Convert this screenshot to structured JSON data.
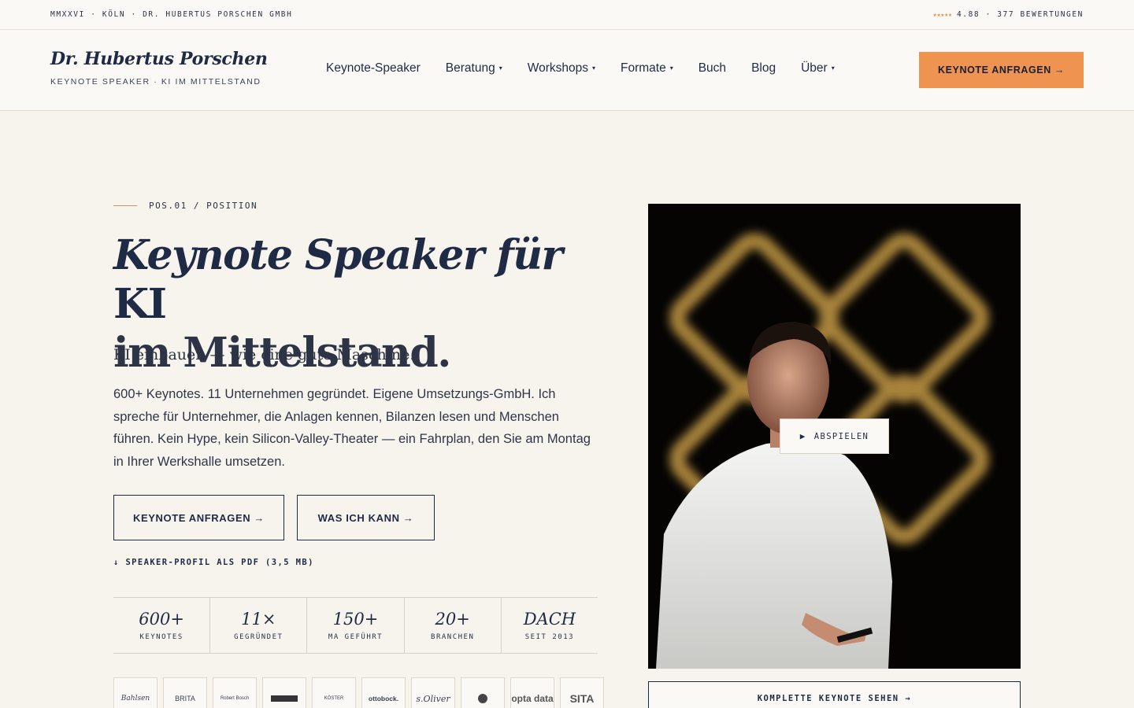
{
  "topbar": {
    "left_text": "MMXXVI · KÖLN · DR. HUBERTUS PORSCHEN GMBH",
    "stars": "★★★★★",
    "rating_text": "4.88 · 377 BEWERTUNGEN"
  },
  "header": {
    "brand_name": "Dr. Hubertus Porschen",
    "brand_tagline": "KEYNOTE SPEAKER · KI IM MITTELSTAND",
    "nav": [
      {
        "label": "Keynote-Speaker",
        "has_dropdown": false
      },
      {
        "label": "Beratung",
        "has_dropdown": true
      },
      {
        "label": "Workshops",
        "has_dropdown": true
      },
      {
        "label": "Formate",
        "has_dropdown": true
      },
      {
        "label": "Buch",
        "has_dropdown": false
      },
      {
        "label": "Blog",
        "has_dropdown": false
      },
      {
        "label": "Über",
        "has_dropdown": true
      }
    ],
    "caret": "▾",
    "cta_label": "KEYNOTE ANFRAGEN →"
  },
  "hero": {
    "eyebrow": "POS.01 / POSITION",
    "headline_em": "Keynote Speaker für",
    "headline_rest": "KI",
    "headline_line2": "im Mittelstand.",
    "tagline": "KI einbauen — wie eine gute Maschine.",
    "lead": "600+ Keynotes. 11 Unternehmen gegründet. Eigene Umsetzungs-GmbH. Ich spreche für Unternehmer, die Anlagen kennen, Bilanzen lesen und Menschen führen. Kein Hype, kein Silicon-Valley-Theater — ein Fahrplan, den Sie am Montag in Ihrer Werkshalle umsetzen.",
    "primary_button": "KEYNOTE ANFRAGEN →",
    "secondary_button": "WAS ICH KANN →",
    "pdf_link": "↓ SPEAKER-PROFIL ALS PDF (3,5 MB)"
  },
  "stats": [
    {
      "value": "600+",
      "label": "KEYNOTES"
    },
    {
      "value": "11×",
      "label": "GEGRÜNDET"
    },
    {
      "value": "150+",
      "label": "MA GEFÜHRT"
    },
    {
      "value": "20+",
      "label": "BRANCHEN"
    },
    {
      "value": "DACH",
      "label": "SEIT 2013"
    }
  ],
  "logos": [
    "Bahlsen",
    "BRITA",
    "Robert Bosch",
    "",
    "KÖSTER",
    "ottobock.",
    "s.Oliver",
    "",
    "opta data",
    "SITA"
  ],
  "media": {
    "play_label": "ABSPIELEN",
    "play_icon": "▶",
    "full_keynote_label": "KOMPLETTE KEYNOTE SEHEN →"
  },
  "colors": {
    "accent": "#ee9350",
    "ink": "#1f2a44",
    "background": "#f7f4ee"
  }
}
